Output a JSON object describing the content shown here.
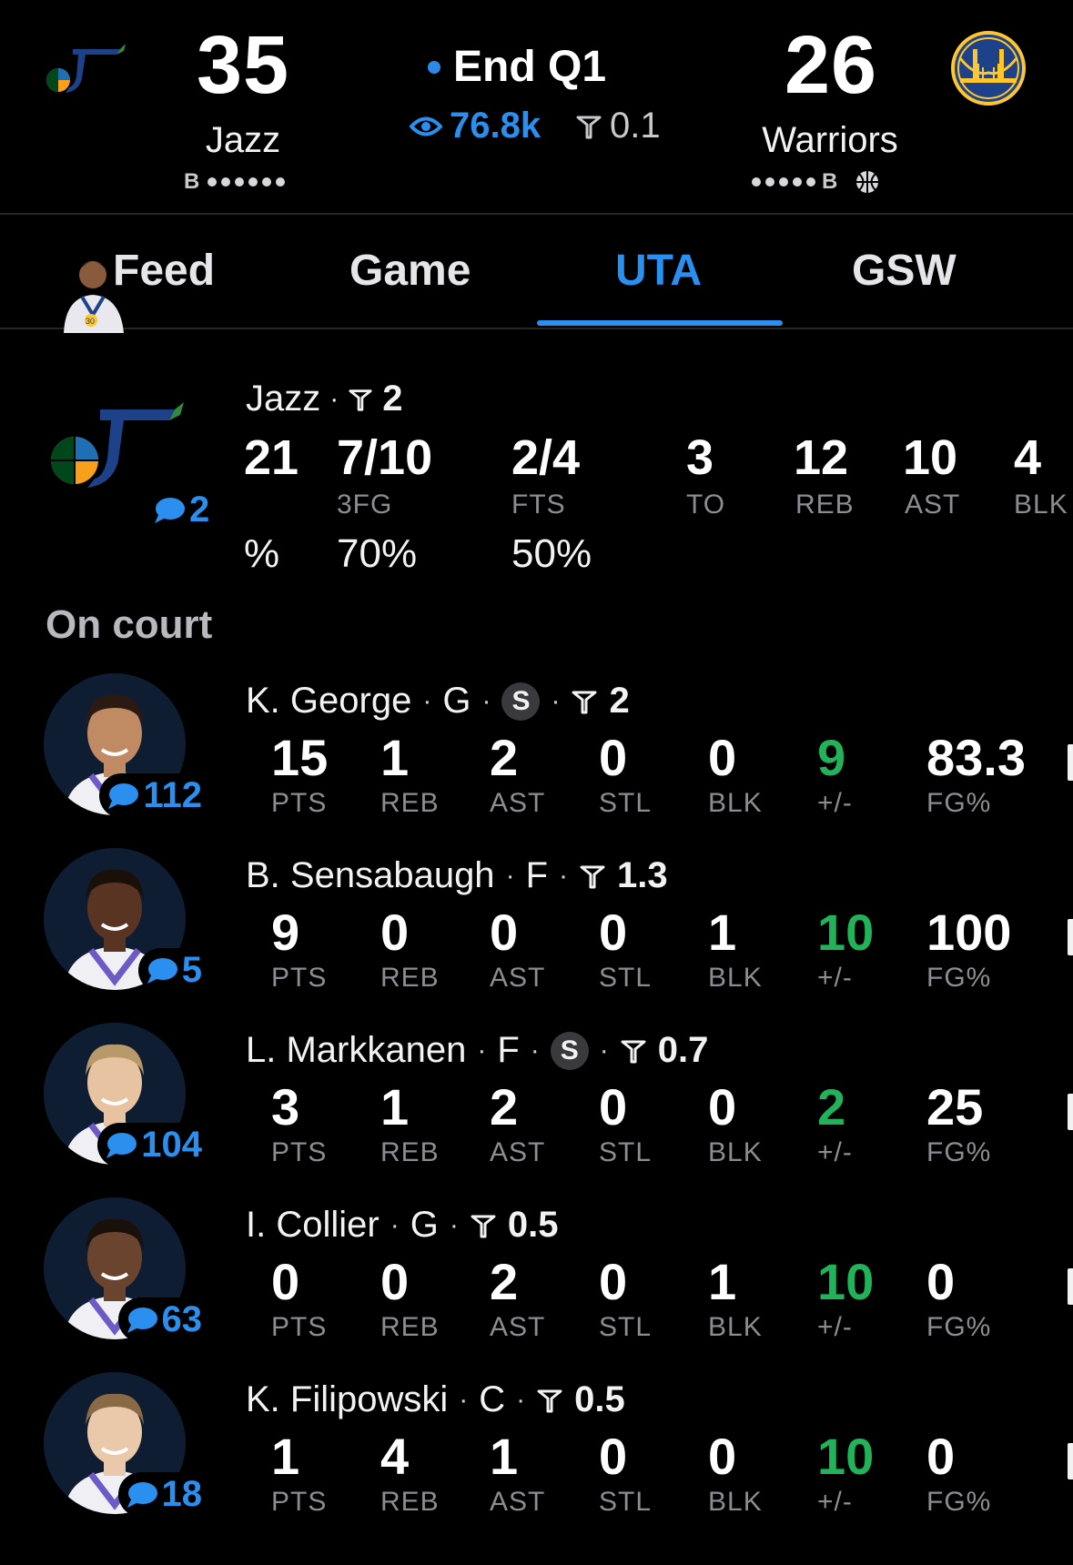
{
  "header": {
    "home": {
      "score": "35",
      "name": "Jazz",
      "bonus_label": "B"
    },
    "away": {
      "score": "26",
      "name": "Warriors",
      "bonus_label": "B"
    },
    "period": "End Q1",
    "viewers": "76.8k",
    "trend_value": "0.1"
  },
  "tabs": {
    "feed": "Feed",
    "game": "Game",
    "uta": "UTA",
    "gsw": "GSW",
    "active": "UTA"
  },
  "team_summary": {
    "name": "Jazz",
    "trend_value": "2",
    "comments": "2",
    "stats": [
      {
        "value": "21",
        "label": "",
        "pct": "%"
      },
      {
        "value": "7/10",
        "label": "3FG",
        "pct": "70%"
      },
      {
        "value": "2/4",
        "label": "FTS",
        "pct": "50%"
      },
      {
        "value": "3",
        "label": "TO",
        "pct": ""
      },
      {
        "value": "12",
        "label": "REB",
        "pct": ""
      },
      {
        "value": "10",
        "label": "AST",
        "pct": ""
      },
      {
        "value": "4",
        "label": "BLK",
        "pct": ""
      }
    ]
  },
  "section_title": "On court",
  "stat_labels": {
    "pts": "PTS",
    "reb": "REB",
    "ast": "AST",
    "stl": "STL",
    "blk": "BLK",
    "pm": "+/-",
    "fg": "FG%"
  },
  "players": [
    {
      "name": "K. George",
      "pos": "G",
      "starter": true,
      "starter_label": "S",
      "trend": "2",
      "comments": "112",
      "pts": "15",
      "reb": "1",
      "ast": "2",
      "stl": "0",
      "blk": "0",
      "pm": "9",
      "fg": "83.3"
    },
    {
      "name": "B. Sensabaugh",
      "pos": "F",
      "starter": false,
      "starter_label": "",
      "trend": "1.3",
      "comments": "5",
      "pts": "9",
      "reb": "0",
      "ast": "0",
      "stl": "0",
      "blk": "1",
      "pm": "10",
      "fg": "100"
    },
    {
      "name": "L. Markkanen",
      "pos": "F",
      "starter": true,
      "starter_label": "S",
      "trend": "0.7",
      "comments": "104",
      "pts": "3",
      "reb": "1",
      "ast": "2",
      "stl": "0",
      "blk": "0",
      "pm": "2",
      "fg": "25"
    },
    {
      "name": "I. Collier",
      "pos": "G",
      "starter": false,
      "starter_label": "",
      "trend": "0.5",
      "comments": "63",
      "pts": "0",
      "reb": "0",
      "ast": "2",
      "stl": "0",
      "blk": "1",
      "pm": "10",
      "fg": "0"
    },
    {
      "name": "K. Filipowski",
      "pos": "C",
      "starter": false,
      "starter_label": "",
      "trend": "0.5",
      "comments": "18",
      "pts": "1",
      "reb": "4",
      "ast": "1",
      "stl": "0",
      "blk": "0",
      "pm": "10",
      "fg": "0"
    }
  ],
  "colors": {
    "accent": "#2a8fee",
    "positive": "#22b35a",
    "background": "#000000",
    "muted": "#8c8c92"
  }
}
